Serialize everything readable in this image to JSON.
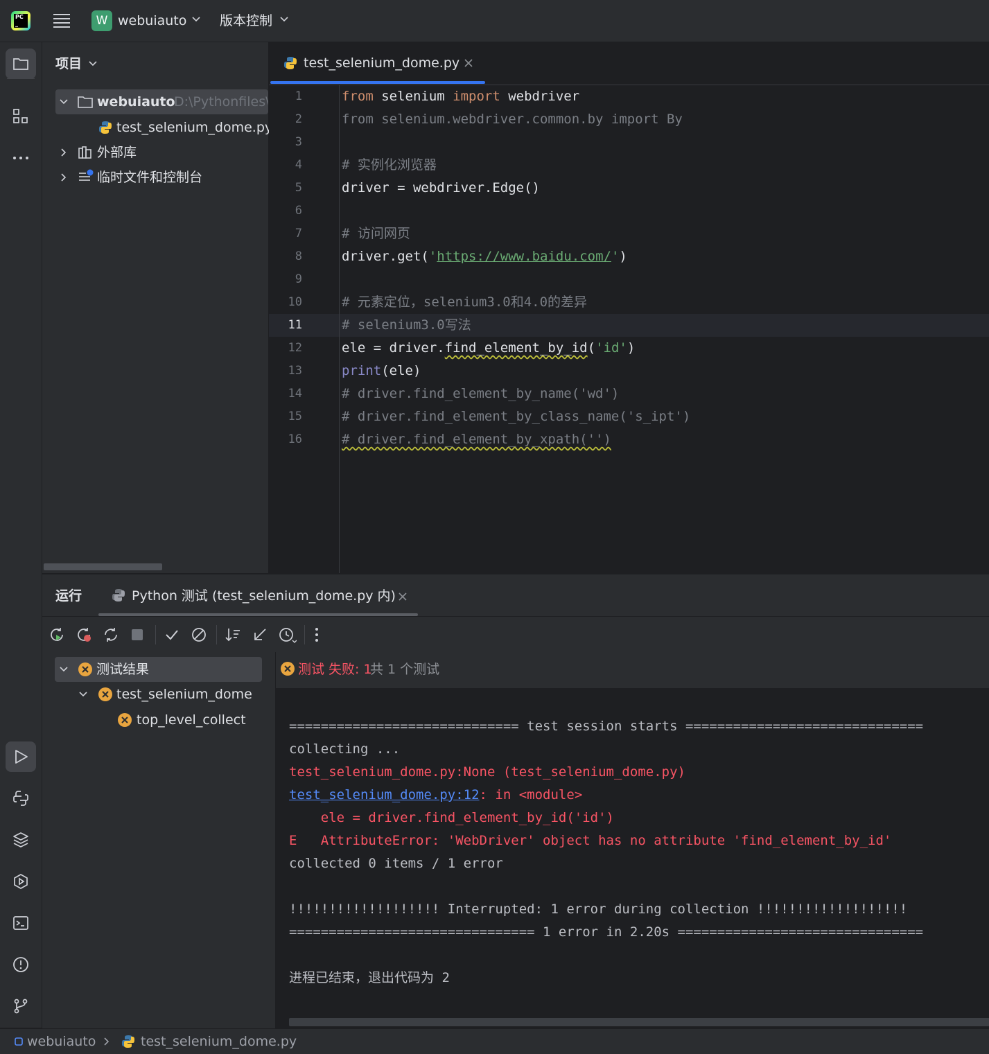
{
  "titlebar": {
    "project_badge": "W",
    "project_name": "webuiauto",
    "vcs_menu": "版本控制"
  },
  "project_panel": {
    "title": "项目",
    "root_name": "webuiauto",
    "root_path": "D:\\Pythonfiles\\",
    "file_name": "test_selenium_dome.py",
    "external_libs": "外部库",
    "scratches": "临时文件和控制台"
  },
  "editor": {
    "tab_label": "test_selenium_dome.py",
    "current_line": 11,
    "line_numbers": [
      "1",
      "2",
      "3",
      "4",
      "5",
      "6",
      "7",
      "8",
      "9",
      "10",
      "11",
      "12",
      "13",
      "14",
      "15",
      "16"
    ],
    "code": {
      "l1_from": "from",
      "l1_mod": " selenium ",
      "l1_import": "import",
      "l1_name": " webdriver",
      "l2": "from selenium.webdriver.common.by import By",
      "l4": "# 实例化浏览器",
      "l5": "driver = webdriver.Edge()",
      "l7": "# 访问网页",
      "l8_pre": "driver.get(",
      "l8_q1": "'",
      "l8_url": "https://www.baidu.com/",
      "l8_q2": "'",
      "l8_post": ")",
      "l10": "# 元素定位，selenium3.0和4.0的差异",
      "l11": "# selenium3.0写法",
      "l12_pre": "ele = driver.",
      "l12_fn": "find_element_by_id",
      "l12_paren": "(",
      "l12_arg": "'id'",
      "l12_post": ")",
      "l13_fn": "print",
      "l13_post": "(ele)",
      "l14": "# driver.find_element_by_name('wd')",
      "l15": "# driver.find_element_by_class_name('s_ipt')",
      "l16": "# driver.find_element_by_xpath('')"
    }
  },
  "run_panel": {
    "title": "运行",
    "tab_label": "Python 测试 (test_selenium_dome.py 内)",
    "tree": {
      "root": "测试结果",
      "module": "test_selenium_dome",
      "item": "top_level_collect"
    },
    "status": {
      "failed_prefix": "测试 失败: 1",
      "total": "共 1 个测试"
    },
    "console": [
      "============================= test session starts ==============================",
      "collecting ...",
      "test_selenium_dome.py:None (test_selenium_dome.py)",
      "",
      "    ele = driver.find_element_by_id('id')",
      "E   AttributeError: 'WebDriver' object has no attribute 'find_element_by_id'",
      "collected 0 items / 1 error",
      "",
      "!!!!!!!!!!!!!!!!!!! Interrupted: 1 error during collection !!!!!!!!!!!!!!!!!!!",
      "=============================== 1 error in 2.20s ===============================",
      "",
      "进程已结束，退出代码为 2"
    ],
    "console_link": "test_selenium_dome.py:12",
    "console_link_rest": ": in <module>"
  },
  "statusbar": {
    "project": "webuiauto",
    "file": "test_selenium_dome.py"
  },
  "colors": {
    "keyword": "#cf8e6d",
    "comment": "#7a7e85",
    "string": "#6aab73",
    "error": "#f75464",
    "link": "#548af7",
    "accent": "#3574f0",
    "fail_badge": "#e9a53f"
  }
}
